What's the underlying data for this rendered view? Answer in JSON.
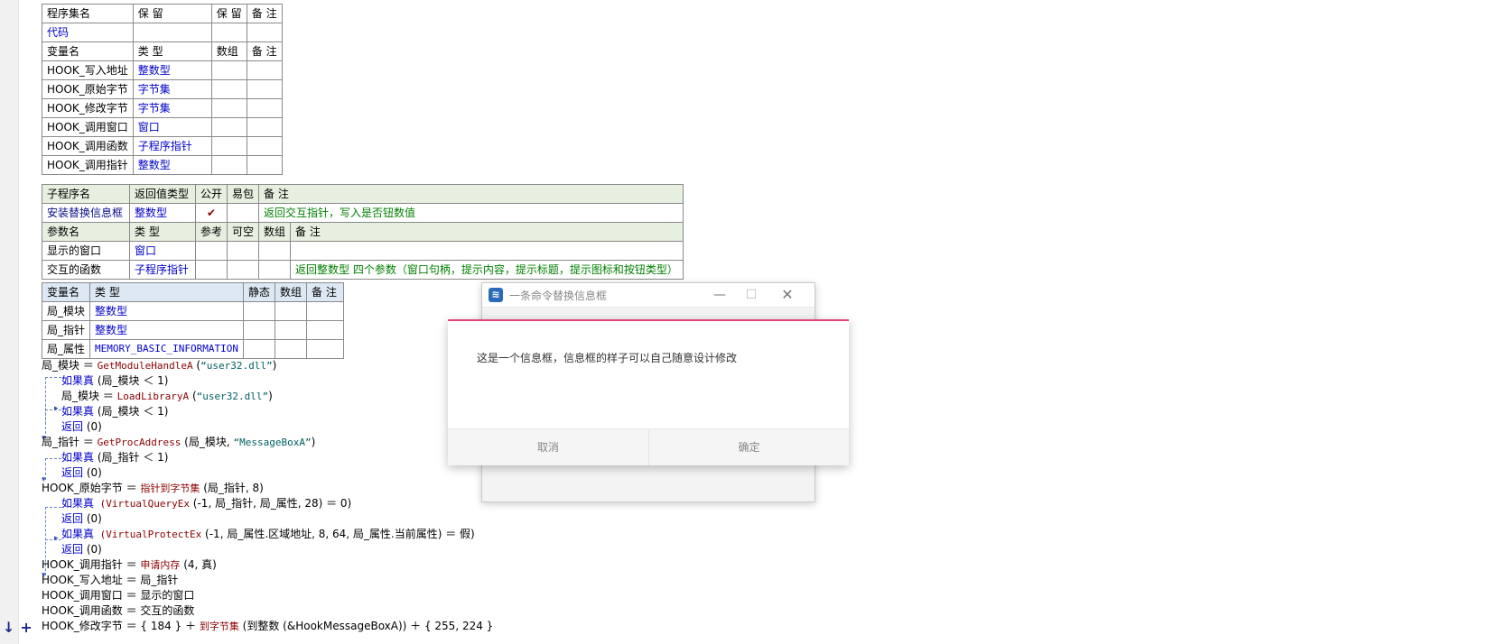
{
  "assembly_table": {
    "header": [
      "程序集名",
      "保 留",
      "保 留",
      "备 注"
    ],
    "name_row": [
      "代码",
      "",
      "",
      ""
    ],
    "var_header": [
      "变量名",
      "类 型",
      "数组",
      "备 注"
    ],
    "vars": [
      {
        "name": "HOOK_写入地址",
        "type": "整数型"
      },
      {
        "name": "HOOK_原始字节",
        "type": "字节集"
      },
      {
        "name": "HOOK_修改字节",
        "type": "字节集"
      },
      {
        "name": "HOOK_调用窗口",
        "type": "窗口"
      },
      {
        "name": "HOOK_调用函数",
        "type": "子程序指针"
      },
      {
        "name": "HOOK_调用指针",
        "type": "整数型"
      }
    ]
  },
  "sub_table": {
    "header": [
      "子程序名",
      "返回值类型",
      "公开",
      "易包",
      "备 注"
    ],
    "sub": {
      "name": "安装替换信息框",
      "return_type": "整数型",
      "public_mark": "✔",
      "remark": "返回交互指针，写入是否钮数值"
    },
    "param_header": [
      "参数名",
      "类 型",
      "参考",
      "可空",
      "数组",
      "备 注"
    ],
    "params": [
      {
        "name": "显示的窗口",
        "type": "窗口",
        "remark": ""
      },
      {
        "name": "交互的函数",
        "type": "子程序指针",
        "remark": "返回整数型 四个参数（窗口句柄，提示内容，提示标题，提示图标和按钮类型）"
      }
    ]
  },
  "local_table": {
    "header": [
      "变量名",
      "类 型",
      "静态",
      "数组",
      "备 注"
    ],
    "vars": [
      {
        "name": "局_模块",
        "type": "整数型"
      },
      {
        "name": "局_指针",
        "type": "整数型"
      },
      {
        "name": "局_属性",
        "type": "MEMORY_BASIC_INFORMATION"
      }
    ]
  },
  "code": {
    "l1": {
      "a": "局_模块 ＝ ",
      "fn": "GetModuleHandleA",
      "b": " (",
      "s": "“user32.dll”",
      "c": ")"
    },
    "l2": {
      "kw": "如果真",
      "b": " (局_模块 ＜ 1)"
    },
    "l3": {
      "a": "局_模块 ＝ ",
      "fn": "LoadLibraryA",
      "b": " (",
      "s": "“user32.dll”",
      "c": ")"
    },
    "l4": {
      "kw": "如果真",
      "b": " (局_模块 ＜ 1)"
    },
    "l5": {
      "kw": "返回",
      "b": " (0)"
    },
    "l6": {
      "a": "局_指针 ＝ ",
      "fn": "GetProcAddress",
      "b": " (局_模块, ",
      "s": "“MessageBoxA”",
      "c": ")"
    },
    "l7": {
      "kw": "如果真",
      "b": " (局_指针 ＜ 1)"
    },
    "l8": {
      "kw": "返回",
      "b": " (0)"
    },
    "l9": {
      "a": "HOOK_原始字节 ＝ ",
      "fn": "指针到字节集",
      "b": " (局_指针, 8)"
    },
    "l10": {
      "kw": "如果真",
      "fn": " (VirtualQueryEx",
      "b": " (-1, 局_指针, 局_属性, 28) ＝ 0)"
    },
    "l11": {
      "kw": "返回",
      "b": " (0)"
    },
    "l12": {
      "kw": "如果真",
      "fn": " (VirtualProtectEx",
      "b": " (-1, 局_属性.区域地址, 8, 64, 局_属性.当前属性) ＝ 假)"
    },
    "l13": {
      "kw": "返回",
      "b": " (0)"
    },
    "l14": {
      "a": "HOOK_调用指针 ＝ ",
      "fn": "申请内存",
      "b": " (4, 真)"
    },
    "l15": {
      "a": "HOOK_写入地址 ＝ 局_指针"
    },
    "l16": {
      "a": "HOOK_调用窗口 ＝ 显示的窗口"
    },
    "l17": {
      "a": "HOOK_调用函数 ＝ 交互的函数"
    },
    "l18": {
      "a": "HOOK_修改字节 ＝ { 184 } ＋ ",
      "fn": "到字节集",
      "b": " (到整数 (&HookMessageBoxA)) ＋ { 255, 224 }"
    }
  },
  "gutter_marks": "↓+",
  "back_window": {
    "title": "一条命令替换信息框",
    "min_icon": "—",
    "max_icon": "☐",
    "close_icon": "✕"
  },
  "dialog": {
    "message": "这是一个信息框，信息框的样子可以自己随意设计修改",
    "cancel_label": "取消",
    "ok_label": "确定",
    "accent": "#e0467c"
  }
}
